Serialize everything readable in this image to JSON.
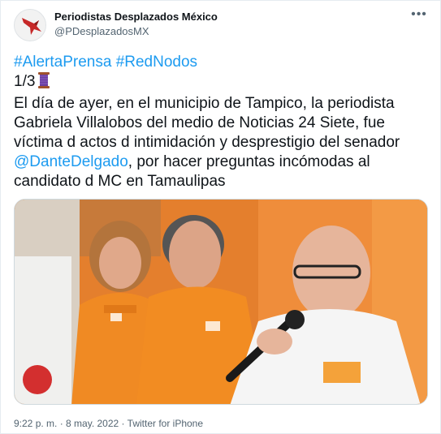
{
  "account": {
    "name": "Periodistas Desplazados México",
    "handle": "@PDesplazadosMX",
    "more_icon": "more-dots-icon",
    "avatar_icon": "red-bird-logo-icon"
  },
  "tweet": {
    "hashtag1": "#AlertaPrensa",
    "hashtag2": "#RedNodos",
    "thread_counter": "1/3",
    "thread_emoji": "spool-of-thread-icon",
    "line1": "El día de ayer, en el municipio de Tampico, la periodista",
    "line2": "Gabriela Villalobos del medio de Noticias 24 Siete, fue",
    "line3": "víctima d actos d intimidación y desprestigio del senador",
    "mention": "@DanteDelgado",
    "line4_rest": ", por hacer preguntas incómodas al",
    "line5": "candidato d MC en Tamaulipas"
  },
  "footer": {
    "time": "9:22 p. m.",
    "separator1": " · ",
    "date": "8 may. 2022",
    "separator2": " · ",
    "source": "Twitter for iPhone"
  },
  "colors": {
    "link": "#1d9bf0",
    "text": "#0f1419",
    "secondary": "#536471",
    "orange": "#e98a3e"
  }
}
